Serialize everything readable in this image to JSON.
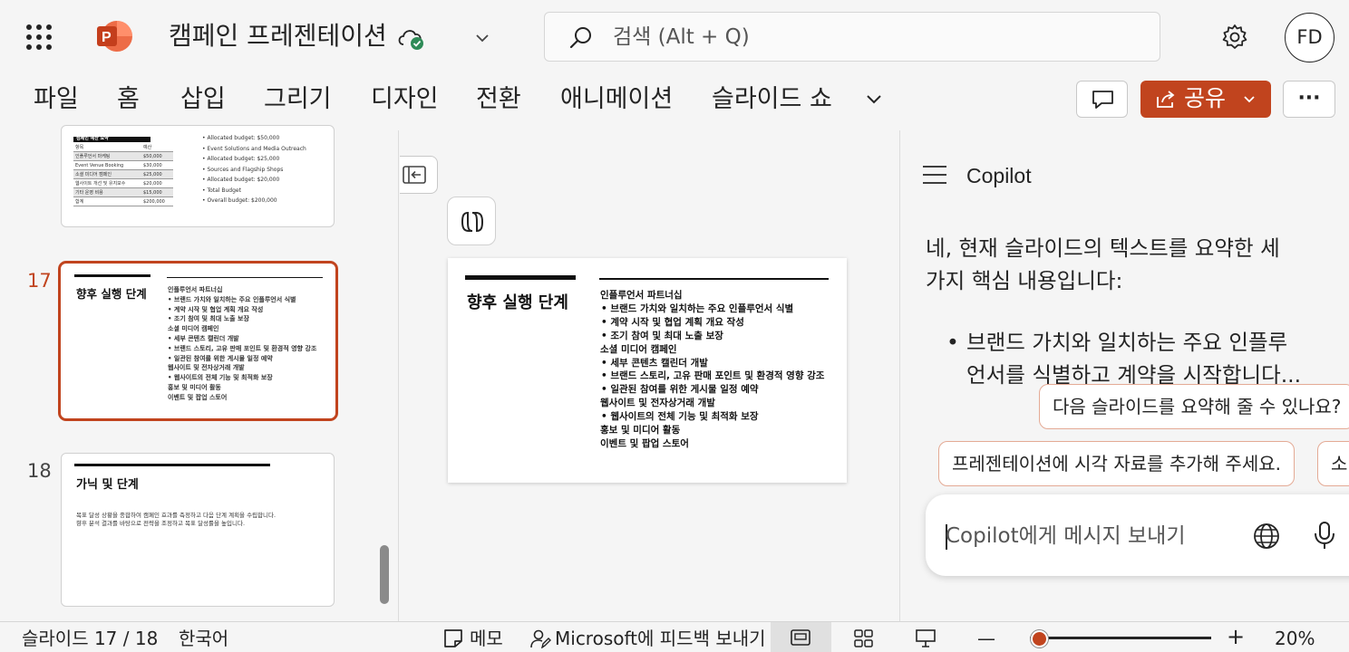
{
  "titlebar": {
    "doc_title": "캠페인 프레젠테이션",
    "search_placeholder": "검색 (Alt + Q)",
    "avatar_initials": "FD"
  },
  "ribbon": {
    "tabs": [
      "파일",
      "홈",
      "삽입",
      "그리기",
      "디자인",
      "전환",
      "애니메이션",
      "슬라이드 쇼"
    ],
    "share_label": "공유",
    "more_label": "···"
  },
  "thumbnails": {
    "slide16": {
      "table_title": "캠페인 예산 요약",
      "rows": [
        [
          "항목",
          "예산"
        ],
        [
          "인플루언서 마케팅",
          "$50,000"
        ],
        [
          "Event Venue Booking",
          "$30,000"
        ],
        [
          "소셜 미디어 캠페인",
          "$25,000"
        ],
        [
          "웹사이트 개선 및 유지보수",
          "$20,000"
        ],
        [
          "기타 운영 비용",
          "$15,000"
        ],
        [
          "합계",
          "$200,000"
        ]
      ],
      "bullets": [
        "• Allocated budget: $50,000",
        "• Event Solutions and Media Outreach",
        "• Allocated budget: $25,000",
        "• Sources and Flagship Shops",
        "• Allocated budget: $20,000",
        "• Total Budget",
        "• Overall budget: $200,000"
      ]
    },
    "slide17": {
      "number": "17",
      "title": "향후 실행 단계",
      "lines": [
        "인플루언서 파트너십",
        "• 브랜드 가치와 일치하는 주요 인플루언서 식별",
        "• 계약 시작 및 협업 계획 개요 작성",
        "• 조기 참여 및 최대 노출 보장",
        "소셜 미디어 캠페인",
        "• 세부 콘텐츠 캘린더 개발",
        "• 브랜드 스토리, 고유 판매 포인트 및 환경적 영향 강조",
        "• 일관된 참여를 위한 게시물 일정 예약",
        "웹사이트 및 전자상거래 개발",
        "• 웹사이트의 전체 기능 및 최적화 보장",
        "홍보 및 미디어 활동",
        "이벤트 및 팝업 스토어"
      ]
    },
    "slide18": {
      "number": "18",
      "title": "가닉 및 단계",
      "body_1": "목표 달성 상황을 종합하여 캠페인 효과를 측정하고 다음 단계 계획을 수립합니다.",
      "body_2": "향후 분석 결과를 바탕으로 전략을 조정하고 목표 달성률을 높입니다."
    }
  },
  "main_slide": {
    "title": "향후 실행 단계",
    "lines": [
      {
        "text": "인플루언서 파트너십",
        "indent": false
      },
      {
        "text": "•  브랜드 가치와 일치하는 주요 인플루언서 식별",
        "indent": true
      },
      {
        "text": "•  계약 시작 및 협업 계획 개요 작성",
        "indent": true
      },
      {
        "text": "•  조기 참여 및 최대 노출 보장",
        "indent": true
      },
      {
        "text": "소셜 미디어 캠페인",
        "indent": false
      },
      {
        "text": "•  세부 콘텐츠 캘린더 개발",
        "indent": true
      },
      {
        "text": "•  브랜드 스토리, 고유 판매 포인트 및 환경적 영향 강조",
        "indent": true
      },
      {
        "text": "•  일관된 참여를 위한 게시물 일정 예약",
        "indent": true
      },
      {
        "text": "웹사이트 및 전자상거래 개발",
        "indent": false
      },
      {
        "text": "•  웹사이트의 전체 기능 및 최적화 보장",
        "indent": true
      },
      {
        "text": "홍보 및 미디어 활동",
        "indent": false
      },
      {
        "text": "이벤트 및 팝업 스토어",
        "indent": false
      }
    ]
  },
  "copilot": {
    "title": "Copilot",
    "response_line_1": "네, 현재 슬라이드의 텍스트를 요약한 세",
    "response_line_2": "가지 핵심 내용입니다:",
    "bullet_line_1": "브랜드 가치와 일치하는 주요 인플루",
    "bullet_line_2": "언서를 식별하고 계약을 시작합니다...",
    "suggestions": [
      "다음 슬라이드를 요약해 줄 수 있나요?",
      "프레젠테이션에 시각 자료를 추가해 주세요.",
      "소"
    ],
    "composer_placeholder": "Copilot에게 메시지 보내기"
  },
  "statusbar": {
    "slide_indicator": "슬라이드 17 / 18",
    "language": "한국어",
    "notes_label": "메모",
    "feedback_label": "Microsoft에 피드백 보내기",
    "zoom_out": "—",
    "zoom_in": "+",
    "zoom_level": "20%",
    "zoom_fraction": 0.05
  },
  "colors": {
    "accent": "#c1441e",
    "background": "#f5f5f5",
    "text": "#242424"
  }
}
